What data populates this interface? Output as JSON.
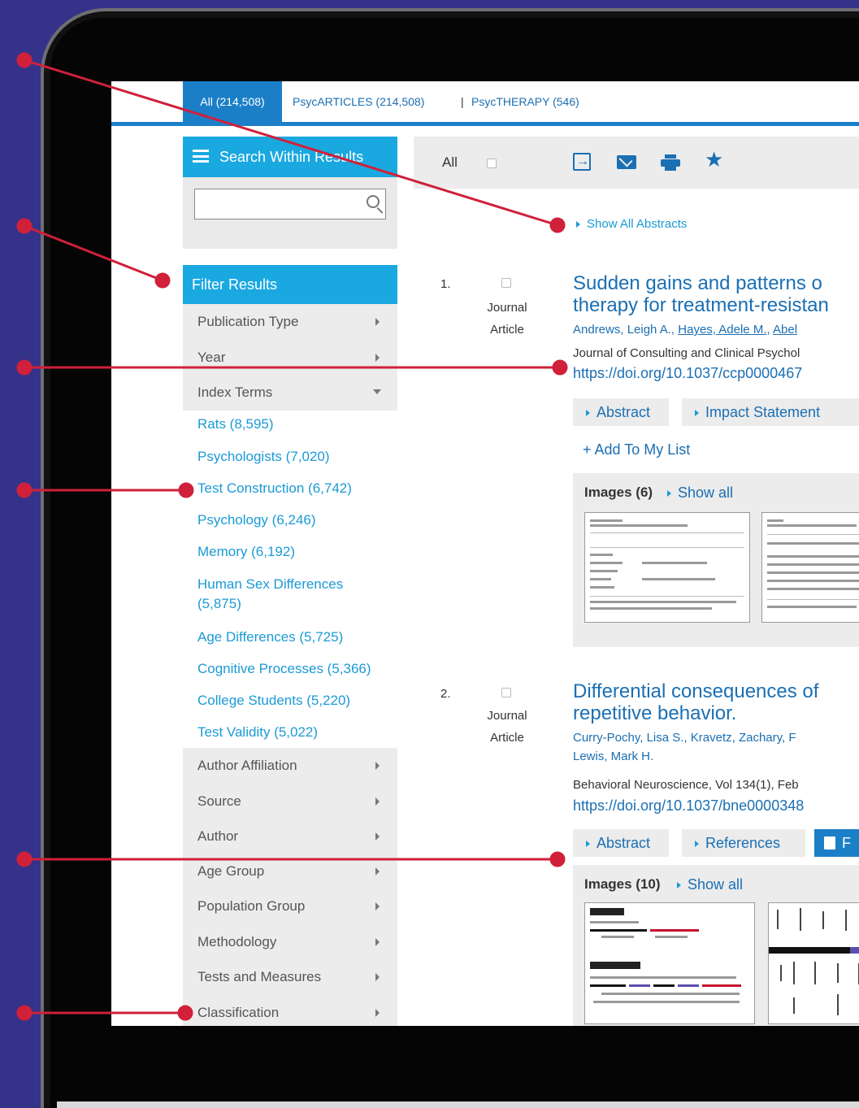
{
  "tabs": {
    "all": "All (214,508)",
    "psycarticles": "PsycARTICLES (214,508)",
    "separator": "|",
    "psyctherapy": "PsycTHERAPY (546)"
  },
  "sidebar": {
    "search_within": "Search Within Results",
    "search_placeholder": "",
    "filter_header": "Filter Results",
    "facets_top": [
      "Publication Type",
      "Year",
      "Index Terms"
    ],
    "index_terms": [
      "Rats (8,595)",
      "Psychologists (7,020)",
      "Test Construction (6,742)",
      "Psychology (6,246)",
      "Memory (6,192)",
      "Human Sex Differences (5,875)",
      "Age Differences (5,725)",
      "Cognitive Processes (5,366)",
      "College Students (5,220)",
      "Test Validity (5,022)"
    ],
    "facets_bottom": [
      "Author Affiliation",
      "Source",
      "Author",
      "Age Group",
      "Population Group",
      "Methodology",
      "Tests and Measures",
      "Classification"
    ]
  },
  "toolbar": {
    "select_all_label": "All",
    "icons": [
      "export-icon",
      "email-icon",
      "print-icon",
      "star-icon"
    ]
  },
  "show_all_abstracts": "Show All Abstracts",
  "results": [
    {
      "number": "1.",
      "type_line1": "Journal",
      "type_line2": "Article",
      "title_line1": "Sudden gains and patterns o",
      "title_line2": "therapy for treatment-resistan",
      "authors_a": "Andrews, Leigh A.",
      "authors_sep1": ", ",
      "authors_b": "Hayes, Adele M.",
      "authors_sep2": ", ",
      "authors_c": "Abel",
      "source": "Journal of Consulting and Clinical Psychol",
      "doi": "https://doi.org/10.1037/ccp0000467",
      "buttons": [
        "Abstract",
        "Impact Statement"
      ],
      "add_to_list": "+ Add To My List",
      "images_label": "Images (6)",
      "show_all": "Show all"
    },
    {
      "number": "2.",
      "type_line1": "Journal",
      "type_line2": "Article",
      "title_line1": "Differential consequences of",
      "title_line2": "repetitive behavior.",
      "authors_line1": "Curry-Pochy, Lisa S., Kravetz, Zachary, F",
      "authors_line2": "Lewis, Mark H.",
      "source": "Behavioral Neuroscience, Vol 134(1), Feb",
      "doi": "https://doi.org/10.1037/bne0000348",
      "buttons": [
        "Abstract",
        "References"
      ],
      "pdf_button": "F",
      "images_label": "Images (10)",
      "show_all": "Show all"
    }
  ],
  "colors": {
    "background": "#35328a",
    "accent_blue": "#1b7fc7",
    "sidebar_blue": "#1aa8e0",
    "link_blue": "#1b6fb3",
    "annotation_red": "#d0203a"
  }
}
